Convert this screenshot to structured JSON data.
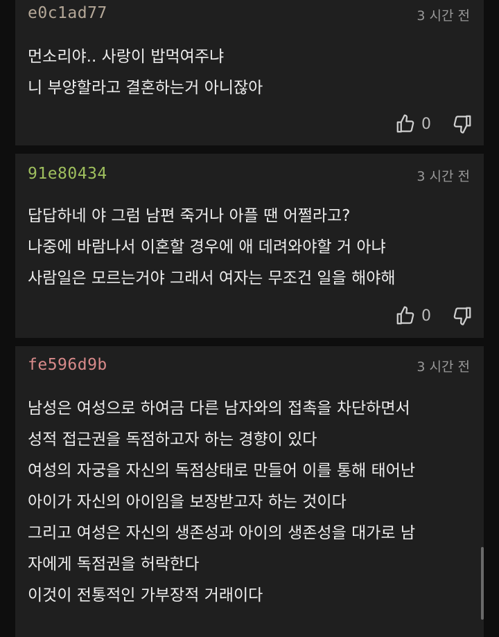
{
  "comments": [
    {
      "author": "e0c1ad77",
      "author_color": "#b5a898",
      "time": "3 시간 전",
      "lines": [
        "먼소리야.. 사랑이 밥먹여주냐",
        "니 부양할라고 결혼하는거 아니잖아"
      ],
      "likes": "0"
    },
    {
      "author": "91e80434",
      "author_color": "#9fbf5e",
      "time": "3 시간 전",
      "lines": [
        "답답하네 야 그럼 남편 죽거나 아플 땐 어쩔라고?",
        "나중에 바람나서 이혼할 경우에 애 데려와야할 거 아냐",
        "사람일은 모르는거야 그래서 여자는 무조건 일을 해야해"
      ],
      "likes": "0"
    },
    {
      "author": "fe596d9b",
      "author_color": "#d88a8a",
      "time": "3 시간 전",
      "lines": [
        "남성은 여성으로 하여금 다른 남자와의 접촉을 차단하면서",
        "성적 접근권을 독점하고자 하는 경향이 있다",
        "여성의 자궁을 자신의 독점상태로 만들어 이를 통해 태어난",
        "아이가 자신의 아이임을 보장받고자 하는 것이다",
        "그리고 여성은 자신의 생존성과 아이의 생존성을 대가로 남",
        "자에게 독점권을 허락한다",
        "이것이 전통적인 가부장적 거래이다"
      ]
    }
  ],
  "icons": {
    "like": "thumbs-up-icon",
    "dislike": "thumbs-down-icon"
  }
}
